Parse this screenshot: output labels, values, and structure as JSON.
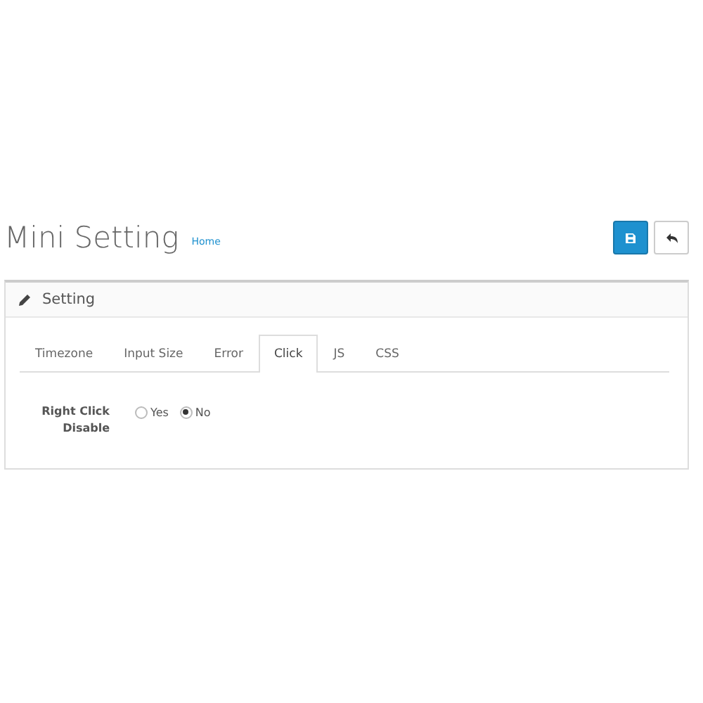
{
  "page": {
    "title": "Mini Setting",
    "breadcrumb": "Home"
  },
  "panel": {
    "title": "Setting"
  },
  "tabs": [
    {
      "label": "Timezone",
      "selected": false
    },
    {
      "label": "Input Size",
      "selected": false
    },
    {
      "label": "Error",
      "selected": false
    },
    {
      "label": "Click",
      "selected": true
    },
    {
      "label": "JS",
      "selected": false
    },
    {
      "label": "CSS",
      "selected": false
    }
  ],
  "field": {
    "label": "Right Click Disable",
    "options": [
      {
        "label": "Yes",
        "selected": false
      },
      {
        "label": "No",
        "selected": true
      }
    ]
  }
}
